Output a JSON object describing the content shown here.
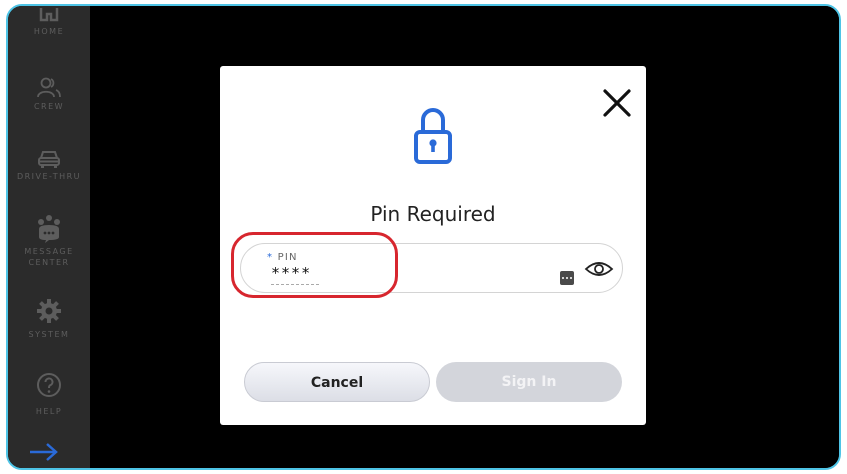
{
  "sidebar": {
    "items": [
      {
        "label": "HOME",
        "icon": "home-icon"
      },
      {
        "label": "CREW",
        "icon": "crew-icon"
      },
      {
        "label": "DRIVE-THRU",
        "icon": "car-icon"
      },
      {
        "label": "MESSAGE CENTER",
        "label_lines": [
          "MESSAGE",
          "CENTER"
        ],
        "icon": "message-center-icon"
      },
      {
        "label": "SYSTEM",
        "icon": "gear-icon"
      },
      {
        "label": "HELP",
        "icon": "help-icon"
      }
    ],
    "bottom_icon": "arrow-right-icon"
  },
  "modal": {
    "title": "Pin Required",
    "icon": "lock-icon",
    "close_icon": "close-icon",
    "pin_field": {
      "required_marker": "*",
      "label": "PIN",
      "value": "****"
    },
    "cancel_label": "Cancel",
    "signin_label": "Sign In"
  },
  "colors": {
    "accent_blue": "#2a6ad8",
    "frame_border": "#4ec4e6",
    "highlight_red": "#d7262e",
    "sidebar_bg": "#2b2b2b"
  }
}
